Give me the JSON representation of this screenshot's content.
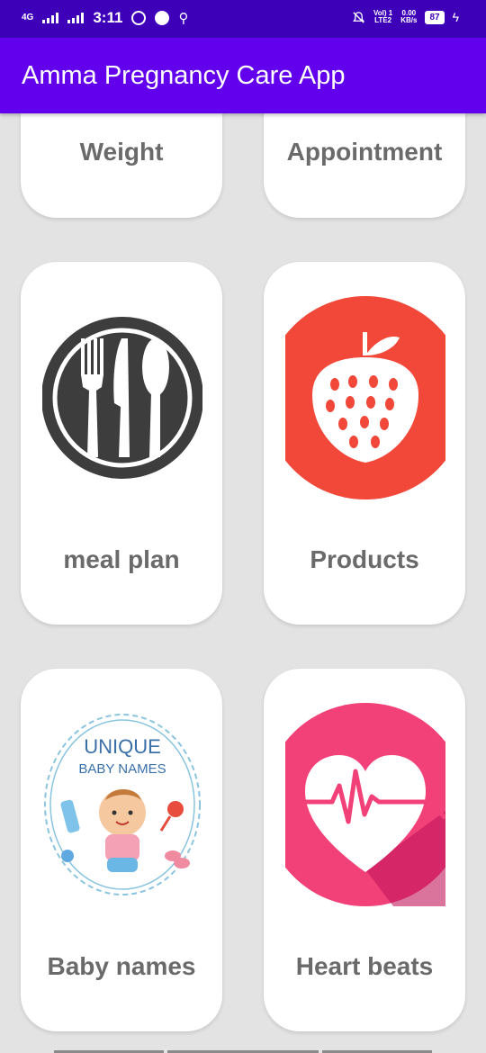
{
  "status_bar": {
    "network": "4G",
    "time": "3:11",
    "volte": "Vol) 1",
    "lte": "LTE2",
    "speed_value": "0.00",
    "speed_unit": "KB/s",
    "battery": "87"
  },
  "app_bar": {
    "title": "Amma Pregnancy Care App"
  },
  "cards": [
    {
      "label": "Weight",
      "icon": "weight-icon"
    },
    {
      "label": "Appointment",
      "icon": "appointment-icon"
    },
    {
      "label": "meal plan",
      "icon": "fork-knife-spoon-icon"
    },
    {
      "label": "Products",
      "icon": "strawberry-icon"
    },
    {
      "label": "Baby names",
      "icon": "baby-names-icon",
      "image_text_1": "UNIQUE",
      "image_text_2": "BABY NAMES"
    },
    {
      "label": "Heart beats",
      "icon": "heartbeat-icon"
    }
  ],
  "colors": {
    "status_bar": "#3d00b8",
    "app_bar": "#6200ee",
    "background": "#e3e3e3",
    "label_text": "#6a6a6a",
    "meal_plate": "#3d3d3d",
    "strawberry_bg": "#f2483a",
    "heart_bg": "#f24078"
  }
}
